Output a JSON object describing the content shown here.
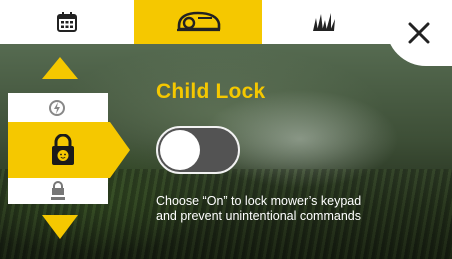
{
  "tabs": [
    {
      "name": "calendar",
      "icon": "calendar-icon",
      "active": false
    },
    {
      "name": "mower",
      "icon": "robot-mower-icon",
      "active": true
    },
    {
      "name": "grass",
      "icon": "grass-icon",
      "active": false
    }
  ],
  "close_icon": "close-icon",
  "menu": {
    "up_icon": "arrow-up-icon",
    "down_icon": "arrow-down-icon",
    "items": [
      {
        "icon": "anti-theft-icon",
        "selected": false
      },
      {
        "icon": "child-lock-icon",
        "selected": true
      },
      {
        "icon": "keypad-lock-icon",
        "selected": false
      }
    ]
  },
  "setting": {
    "title": "Child Lock",
    "toggle_state": "off",
    "description_line1": "Choose “On” to lock mower’s keypad",
    "description_line2": "and prevent unintentional commands"
  },
  "colors": {
    "accent": "#f5c800",
    "toggle_bg": "#535353",
    "background": "#3d4e36"
  }
}
